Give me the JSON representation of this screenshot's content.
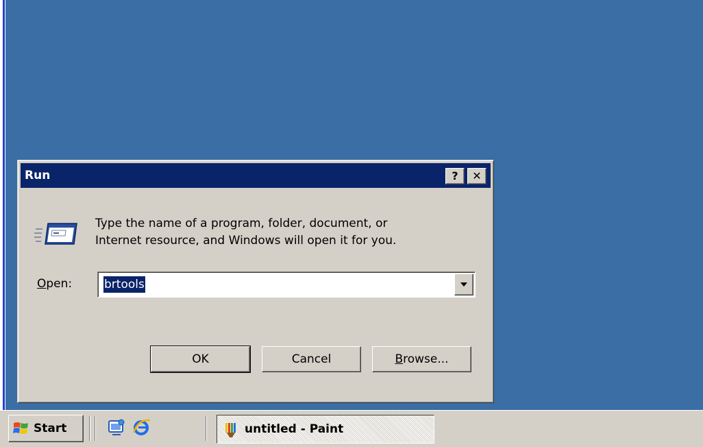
{
  "dialog": {
    "title": "Run",
    "help_label": "?",
    "close_label": "✕",
    "description_line1": "Type the name of a program, folder, document, or",
    "description_line2": "Internet resource, and Windows will open it for you.",
    "open_label_prefix": "O",
    "open_label_rest": "pen:",
    "open_value": "brtools",
    "ok_label": "OK",
    "cancel_label": "Cancel",
    "browse_label_prefix": "B",
    "browse_label_rest": "rowse..."
  },
  "taskbar": {
    "start_label": "Start",
    "quick_launch": [
      "show-desktop-icon",
      "internet-explorer-icon"
    ],
    "tasks": [
      {
        "label": "untitled - Paint",
        "icon": "paint-icon",
        "active": true
      }
    ]
  },
  "colors": {
    "desktop": "#3a6ea5",
    "titlebar": "#0a246a",
    "face": "#d4d0c8",
    "selection": "#0a246a"
  }
}
